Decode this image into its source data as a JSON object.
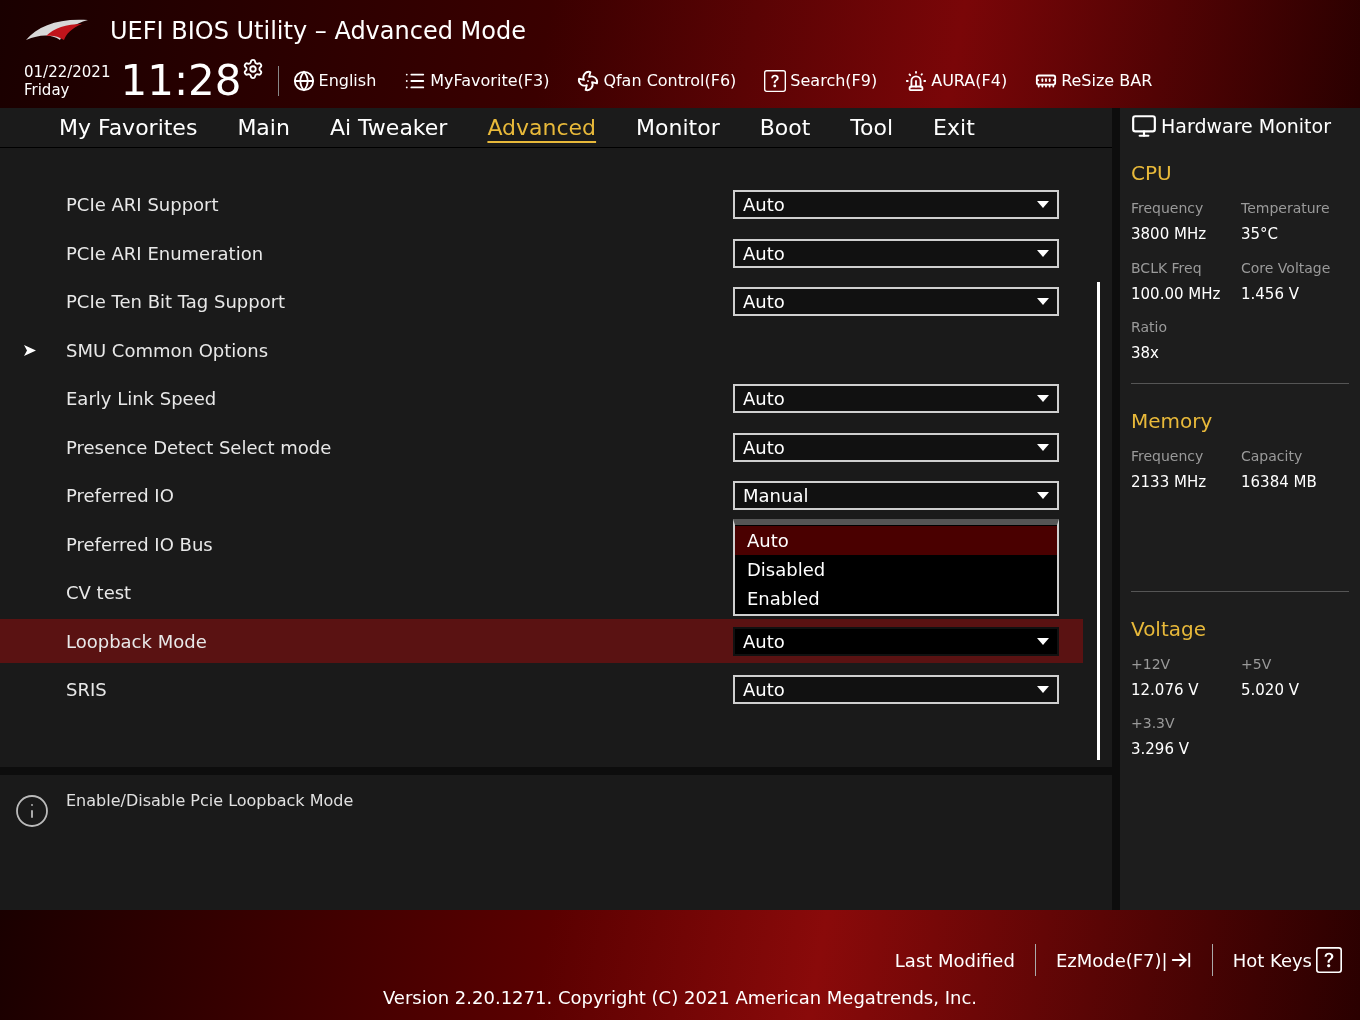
{
  "header": {
    "title": "UEFI BIOS Utility – Advanced Mode",
    "date": "01/22/2021",
    "day": "Friday",
    "time": "11:28",
    "toolbar": [
      {
        "label": "English",
        "kind": "globe"
      },
      {
        "label": "MyFavorite(F3)",
        "kind": "favorite"
      },
      {
        "label": "Qfan Control(F6)",
        "kind": "fan"
      },
      {
        "label": "Search(F9)",
        "kind": "search"
      },
      {
        "label": "AURA(F4)",
        "kind": "aura"
      },
      {
        "label": "ReSize BAR",
        "kind": "card"
      }
    ]
  },
  "tabs": [
    {
      "label": "My Favorites",
      "selected": false
    },
    {
      "label": "Main",
      "selected": false
    },
    {
      "label": "Ai Tweaker",
      "selected": false
    },
    {
      "label": "Advanced",
      "selected": true
    },
    {
      "label": "Monitor",
      "selected": false
    },
    {
      "label": "Boot",
      "selected": false
    },
    {
      "label": "Tool",
      "selected": false
    },
    {
      "label": "Exit",
      "selected": false
    }
  ],
  "settings": [
    {
      "label": "PCIe ARI Support",
      "kind": "dropdown",
      "value": "Auto",
      "selected": false
    },
    {
      "label": "PCIe ARI Enumeration",
      "kind": "dropdown",
      "value": "Auto",
      "selected": false
    },
    {
      "label": "PCIe Ten Bit Tag Support",
      "kind": "dropdown",
      "value": "Auto",
      "selected": false
    },
    {
      "label": "SMU Common Options",
      "kind": "submenu",
      "selected": false
    },
    {
      "label": "Early Link Speed",
      "kind": "dropdown",
      "value": "Auto",
      "selected": false
    },
    {
      "label": "Presence Detect Select mode",
      "kind": "dropdown",
      "value": "Auto",
      "selected": false
    },
    {
      "label": "Preferred IO",
      "kind": "dropdown",
      "value": "Manual",
      "selected": false
    },
    {
      "label": "Preferred IO Bus",
      "kind": "open_dropdown",
      "selected": false,
      "options": [
        {
          "label": "Auto",
          "selected": true
        },
        {
          "label": "Disabled",
          "selected": false
        },
        {
          "label": "Enabled",
          "selected": false
        }
      ]
    },
    {
      "label": "CV test",
      "kind": "plain",
      "selected": false
    },
    {
      "label": "Loopback Mode",
      "kind": "dropdown",
      "value": "Auto",
      "selected": true
    },
    {
      "label": "SRIS",
      "kind": "dropdown",
      "value": "Auto",
      "selected": false
    }
  ],
  "help": {
    "text": "Enable/Disable Pcie Loopback Mode"
  },
  "hardware_monitor": {
    "title": "Hardware Monitor",
    "sections": [
      {
        "title": "CPU",
        "items": [
          {
            "label": "Frequency",
            "value": "3800 MHz"
          },
          {
            "label": "Temperature",
            "value": "35°C"
          },
          {
            "label": "BCLK Freq",
            "value": "100.00 MHz"
          },
          {
            "label": "Core Voltage",
            "value": "1.456 V"
          },
          {
            "label": "Ratio",
            "value": "38x"
          }
        ]
      },
      {
        "title": "Memory",
        "items": [
          {
            "label": "Frequency",
            "value": "2133 MHz"
          },
          {
            "label": "Capacity",
            "value": "16384 MB"
          }
        ]
      },
      {
        "title": "Voltage",
        "items": [
          {
            "label": "+12V",
            "value": "12.076 V"
          },
          {
            "label": "+5V",
            "value": "5.020 V"
          },
          {
            "label": "+3.3V",
            "value": "3.296 V"
          }
        ]
      }
    ]
  },
  "footer": {
    "buttons": [
      {
        "label": "Last Modified",
        "kind": "text"
      },
      {
        "label": "EzMode(F7)|",
        "kind": "exit"
      },
      {
        "label": "Hot Keys",
        "kind": "help"
      }
    ],
    "version": "Version 2.20.1271. Copyright (C) 2021 American Megatrends, Inc."
  }
}
